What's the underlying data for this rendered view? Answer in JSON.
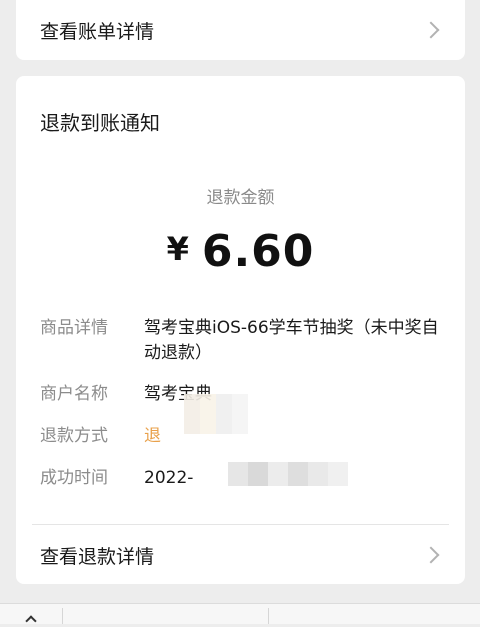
{
  "bill_link": {
    "label": "查看账单详情"
  },
  "notice": {
    "title": "退款到账通知",
    "amount_label": "退款金额",
    "currency_symbol": "¥",
    "amount": "6.60",
    "details": [
      {
        "key": "商品详情",
        "value": "驾考宝典iOS-66学车节抽奖（未中奖自动退款）"
      },
      {
        "key": "商户名称",
        "value": "驾考宝典"
      },
      {
        "key": "退款方式",
        "value": "退"
      },
      {
        "key": "成功时间",
        "value": "2022-"
      }
    ],
    "refund_link": {
      "label": "查看退款详情"
    }
  },
  "colors": {
    "background": "#ededed",
    "card": "#ffffff",
    "refund_method_accent": "#e9a14b",
    "label_gray": "#8c8c8c"
  },
  "icons": [
    "chevron-right-icon",
    "chevron-up-icon"
  ]
}
